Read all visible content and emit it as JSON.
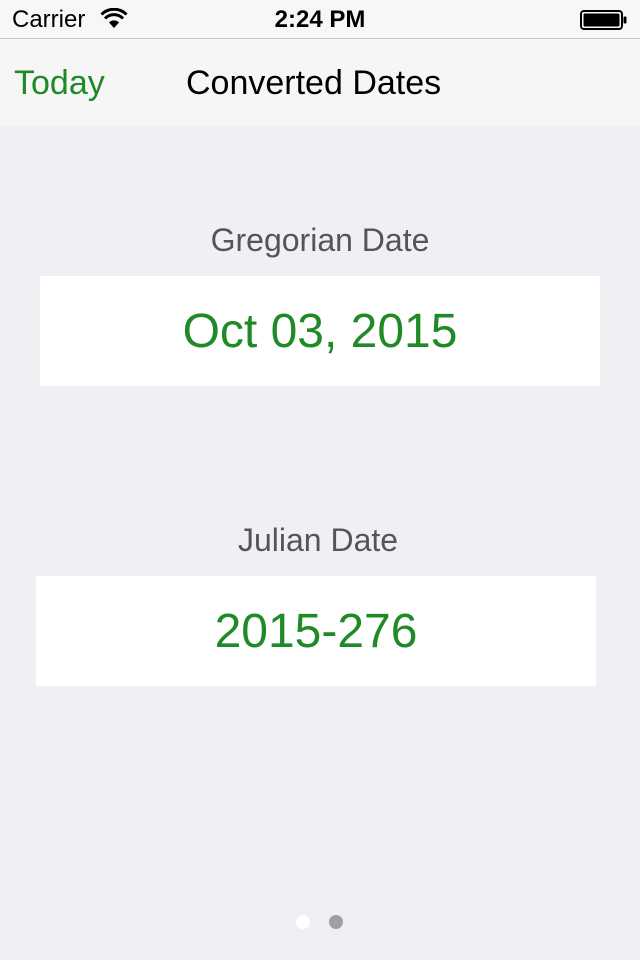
{
  "status_bar": {
    "carrier": "Carrier",
    "time": "2:24 PM",
    "wifi_icon": "wifi-icon",
    "battery_icon": "battery-icon"
  },
  "nav_bar": {
    "left_button": "Today",
    "title": "Converted Dates"
  },
  "sections": {
    "gregorian": {
      "label": "Gregorian Date",
      "value": "Oct 03, 2015"
    },
    "julian": {
      "label": "Julian Date",
      "value": "2015-276"
    }
  },
  "page_control": {
    "pages": 2,
    "current_page": 1
  },
  "colors": {
    "accent": "#1f8a26",
    "background": "#efeff4",
    "label_text": "#555555",
    "page_dot_active": "#ffffff",
    "page_dot_inactive": "#a0a0a0"
  }
}
